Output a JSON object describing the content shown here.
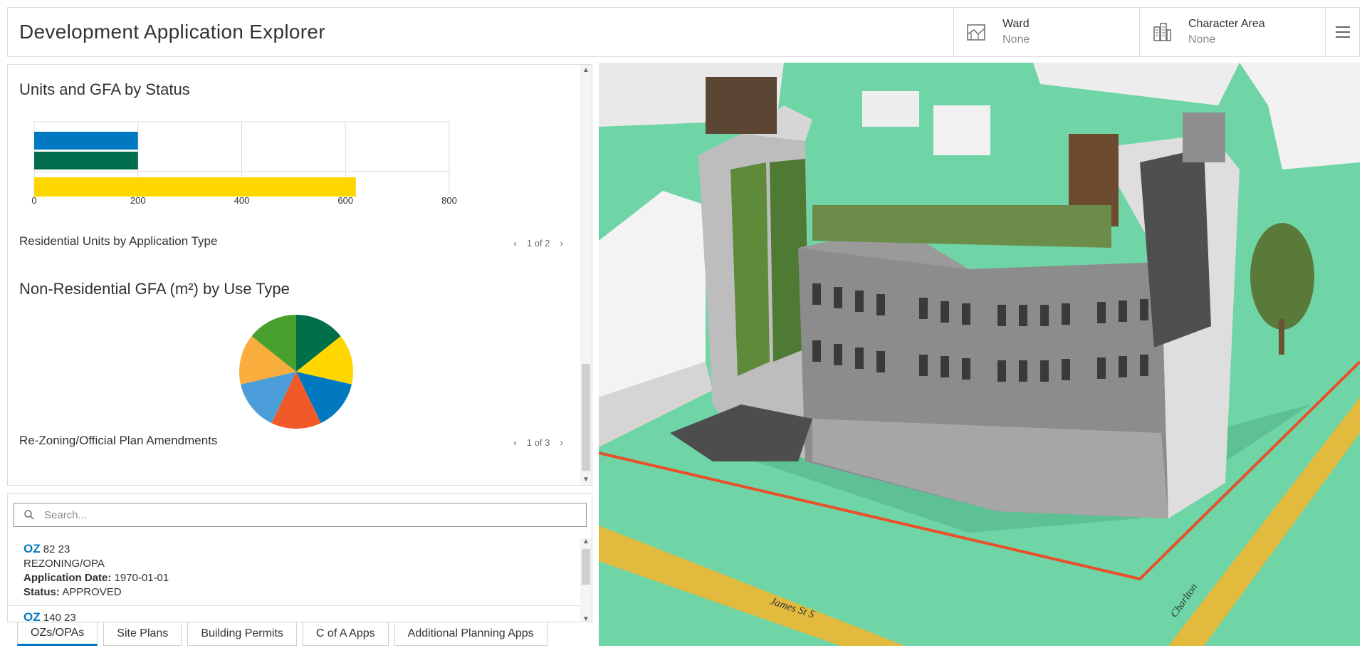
{
  "header": {
    "title": "Development Application Explorer",
    "filters": [
      {
        "label": "Ward",
        "value": "None",
        "icon": "ward-map-icon"
      },
      {
        "label": "Character Area",
        "value": "None",
        "icon": "buildings-icon"
      }
    ],
    "menu_icon": "hamburger-menu-icon"
  },
  "panel": {
    "chart1": {
      "title": "Units and GFA by Status",
      "sub_label": "Residential Units by Application Type",
      "pager": "1 of 2"
    },
    "chart2": {
      "title": "Non-Residential GFA (m²) by Use Type",
      "sub_label": "Re-Zoning/Official Plan Amendments",
      "pager": "1 of 3"
    }
  },
  "chart_data": [
    {
      "type": "bar",
      "orientation": "horizontal",
      "title": "Units and GFA by Status",
      "categories": [
        "",
        "",
        ""
      ],
      "values": [
        200,
        200,
        620
      ],
      "colors": [
        "#0079c1",
        "#006e4e",
        "#ffd700"
      ],
      "xlim": [
        0,
        800
      ],
      "xticks": [
        "0",
        "200",
        "400",
        "600",
        "800"
      ],
      "grid": true
    },
    {
      "type": "pie",
      "title": "Non-Residential GFA (m²) by Use Type",
      "values": [
        1,
        1,
        1,
        1,
        1,
        1,
        1
      ],
      "colors": [
        "#00704a",
        "#ffd700",
        "#0079c1",
        "#f05a28",
        "#4c9edb",
        "#f9ad3d",
        "#4aa02c"
      ]
    }
  ],
  "search": {
    "placeholder": "Search..."
  },
  "list": [
    {
      "prefix": "OZ",
      "code": "82 23",
      "type": "REZONING/OPA",
      "date_label": "Application Date:",
      "date": "1970-01-01",
      "status_label": "Status:",
      "status": "APPROVED"
    },
    {
      "prefix": "OZ",
      "code": "140 23"
    }
  ],
  "tabs": [
    "OZs/OPAs",
    "Site Plans",
    "Building Permits",
    "C of A Apps",
    "Additional Planning Apps"
  ],
  "map": {
    "street_labels": [
      "James St S",
      "Charlton"
    ],
    "colors": {
      "ground": "#6fd5a6",
      "road": "#e8b838",
      "boundary": "#e8502a"
    }
  },
  "colors": {
    "accent": "#0079c1"
  }
}
